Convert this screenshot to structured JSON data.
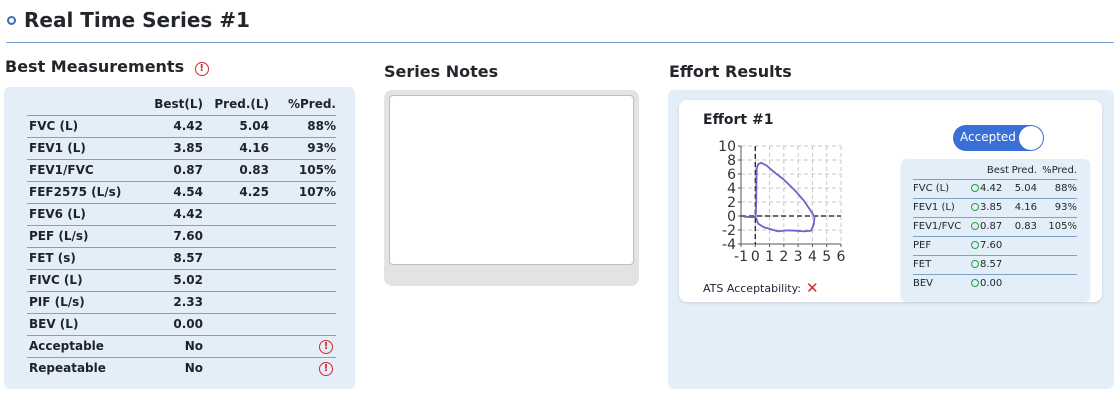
{
  "page": {
    "title": "Real Time Series #1"
  },
  "best_measurements": {
    "title": "Best Measurements",
    "headers": [
      "",
      "Best(L)",
      "Pred.(L)",
      "%Pred."
    ],
    "rows": [
      {
        "label": "FVC (L)",
        "best": "4.42",
        "pred": "5.04",
        "pct": "88%"
      },
      {
        "label": "FEV1 (L)",
        "best": "3.85",
        "pred": "4.16",
        "pct": "93%"
      },
      {
        "label": "FEV1/FVC",
        "best": "0.87",
        "pred": "0.83",
        "pct": "105%"
      },
      {
        "label": "FEF2575 (L/s)",
        "best": "4.54",
        "pred": "4.25",
        "pct": "107%"
      },
      {
        "label": "FEV6 (L)",
        "best": "4.42",
        "pred": "",
        "pct": ""
      },
      {
        "label": "PEF (L/s)",
        "best": "7.60",
        "pred": "",
        "pct": ""
      },
      {
        "label": "FET (s)",
        "best": "8.57",
        "pred": "",
        "pct": ""
      },
      {
        "label": "FIVC (L)",
        "best": "5.02",
        "pred": "",
        "pct": ""
      },
      {
        "label": "PIF (L/s)",
        "best": "2.33",
        "pred": "",
        "pct": ""
      },
      {
        "label": "BEV (L)",
        "best": "0.00",
        "pred": "",
        "pct": ""
      }
    ],
    "acceptable": {
      "label": "Acceptable",
      "value": "No"
    },
    "repeatable": {
      "label": "Repeatable",
      "value": "No"
    }
  },
  "series_notes": {
    "title": "Series Notes",
    "text": ""
  },
  "effort_results": {
    "title": "Effort Results",
    "effort": {
      "title": "Effort #1",
      "toggle_label": "Accepted",
      "accepted": true,
      "ats_label": "ATS Acceptability:",
      "headers": [
        "",
        "Best",
        "Pred.",
        "%Pred."
      ],
      "rows": [
        {
          "label": "FVC (L)",
          "best": "4.42",
          "pred": "5.04",
          "pct": "88%"
        },
        {
          "label": "FEV1 (L)",
          "best": "3.85",
          "pred": "4.16",
          "pct": "93%"
        },
        {
          "label": "FEV1/FVC",
          "best": "0.87",
          "pred": "0.83",
          "pct": "105%"
        },
        {
          "label": "PEF",
          "best": "7.60",
          "pred": "",
          "pct": ""
        },
        {
          "label": "FET",
          "best": "8.57",
          "pred": "",
          "pct": ""
        },
        {
          "label": "BEV",
          "best": "0.00",
          "pred": "",
          "pct": ""
        }
      ]
    }
  },
  "colors": {
    "accent": "#3a6fb0",
    "panel_bg": "#e4eef9",
    "alert": "#d9262d",
    "ok": "#2a9d3a",
    "curve": "#6b67c7",
    "toggle": "#3b6fd8"
  },
  "icons": [
    "section-ring-icon",
    "alert-circle-icon",
    "close-x-icon",
    "check-circle-icon"
  ],
  "chart_data": {
    "type": "line",
    "title": "",
    "xlabel": "",
    "ylabel": "",
    "xlim": [
      -1,
      6
    ],
    "ylim": [
      -4,
      10
    ],
    "x_ticks": [
      -1,
      0,
      1,
      2,
      3,
      4,
      5,
      6
    ],
    "y_ticks": [
      10,
      8,
      6,
      4,
      2,
      0,
      -2,
      -4
    ],
    "grid": true,
    "series": [
      {
        "values": [
          [
            -0.8,
            -0.1
          ],
          [
            -0.3,
            -0.15
          ],
          [
            0.0,
            -0.15
          ],
          [
            0.05,
            0.5
          ],
          [
            0.1,
            6.8
          ],
          [
            0.2,
            7.4
          ],
          [
            0.4,
            7.6
          ],
          [
            0.8,
            7.2
          ],
          [
            1.3,
            6.3
          ],
          [
            2.0,
            5.2
          ],
          [
            2.8,
            3.6
          ],
          [
            3.4,
            2.2
          ],
          [
            3.8,
            1.0
          ],
          [
            4.05,
            0.2
          ],
          [
            4.15,
            -0.1
          ],
          [
            4.1,
            -1.2
          ],
          [
            3.9,
            -2.1
          ],
          [
            3.4,
            -2.2
          ],
          [
            2.8,
            -2.1
          ],
          [
            2.2,
            -2.05
          ],
          [
            1.6,
            -2.2
          ],
          [
            1.1,
            -1.9
          ],
          [
            0.6,
            -1.6
          ],
          [
            0.2,
            -1.1
          ],
          [
            0.05,
            -0.2
          ]
        ]
      }
    ]
  }
}
